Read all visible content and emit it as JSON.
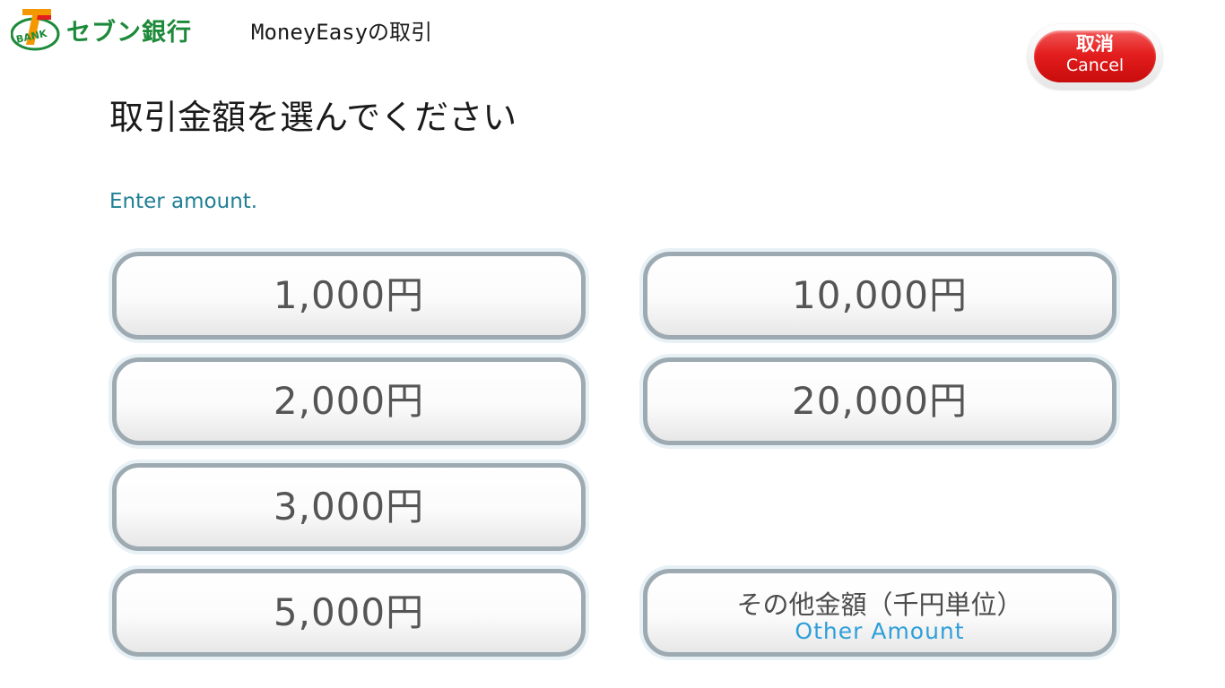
{
  "header": {
    "logo_badge_text": "BANK",
    "logo_text": "セブン銀行",
    "title": "MoneyEasyの取引"
  },
  "cancel": {
    "label_jp": "取消",
    "label_en": "Cancel"
  },
  "instruction": {
    "jp": "取引金額を選んでください",
    "en": "Enter amount."
  },
  "amounts": {
    "a1000": "1,000円",
    "a2000": "2,000円",
    "a3000": "3,000円",
    "a5000": "5,000円",
    "a10000": "10,000円",
    "a20000": "20,000円"
  },
  "other_amount": {
    "label_jp": "その他金額（千円単位）",
    "label_en": "Other Amount"
  },
  "colors": {
    "brand_green": "#1d8a3a",
    "brand_red": "#e41e1e",
    "brand_orange": "#f39800",
    "cancel_red": "#e41e1e",
    "instruction_en": "#1f7f95",
    "other_en": "#2e9fd9",
    "button_border": "#9eaab2"
  }
}
